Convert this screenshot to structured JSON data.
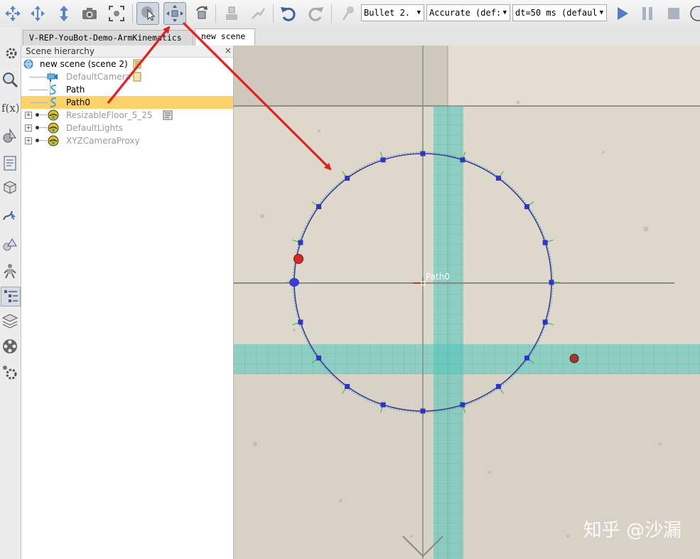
{
  "toolbar": {
    "engine": "Bullet 2.",
    "accuracy": "Accurate (def:",
    "timestep": "dt=50 ms (defaul"
  },
  "tabs": [
    {
      "label": "V-REP-YouBot-Demo-ArmKinematics"
    },
    {
      "label": "new scene"
    }
  ],
  "hierarchy": {
    "title": "Scene hierarchy",
    "close": "×",
    "root": "new scene (scene 2)",
    "items": [
      {
        "label": "DefaultCamera"
      },
      {
        "label": "Path"
      },
      {
        "label": "Path0"
      },
      {
        "label": "ResizableFloor_5_25"
      },
      {
        "label": "DefaultLights"
      },
      {
        "label": "XYZCameraProxy"
      }
    ]
  },
  "viewport": {
    "object_label": "Path0",
    "watermark": "知乎 @沙漏"
  }
}
